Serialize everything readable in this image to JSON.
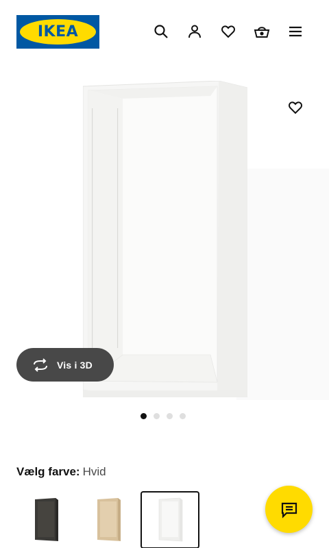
{
  "header": {
    "logo_text": "IKEA",
    "icons": [
      "search-icon",
      "account-icon",
      "favorites-icon",
      "basket-icon",
      "menu-icon"
    ]
  },
  "gallery": {
    "favorite_icon": "heart-icon",
    "view_3d_label": "Vis i 3D",
    "view_3d_icon": "rotate-3d-icon",
    "pages_total": 4,
    "active_page": 1
  },
  "color_picker": {
    "label": "Vælg farve:",
    "selected_value": "Hvid",
    "swatches": [
      {
        "color": "#3b3a37",
        "selected": false
      },
      {
        "color": "#d8c19c",
        "selected": false
      },
      {
        "color": "#f3f3f3",
        "selected": true
      }
    ]
  },
  "chat": {
    "icon": "chat-icon"
  },
  "colors": {
    "brand_blue": "#0058a3",
    "brand_yellow": "#ffdb00",
    "button_dark": "#484848"
  }
}
